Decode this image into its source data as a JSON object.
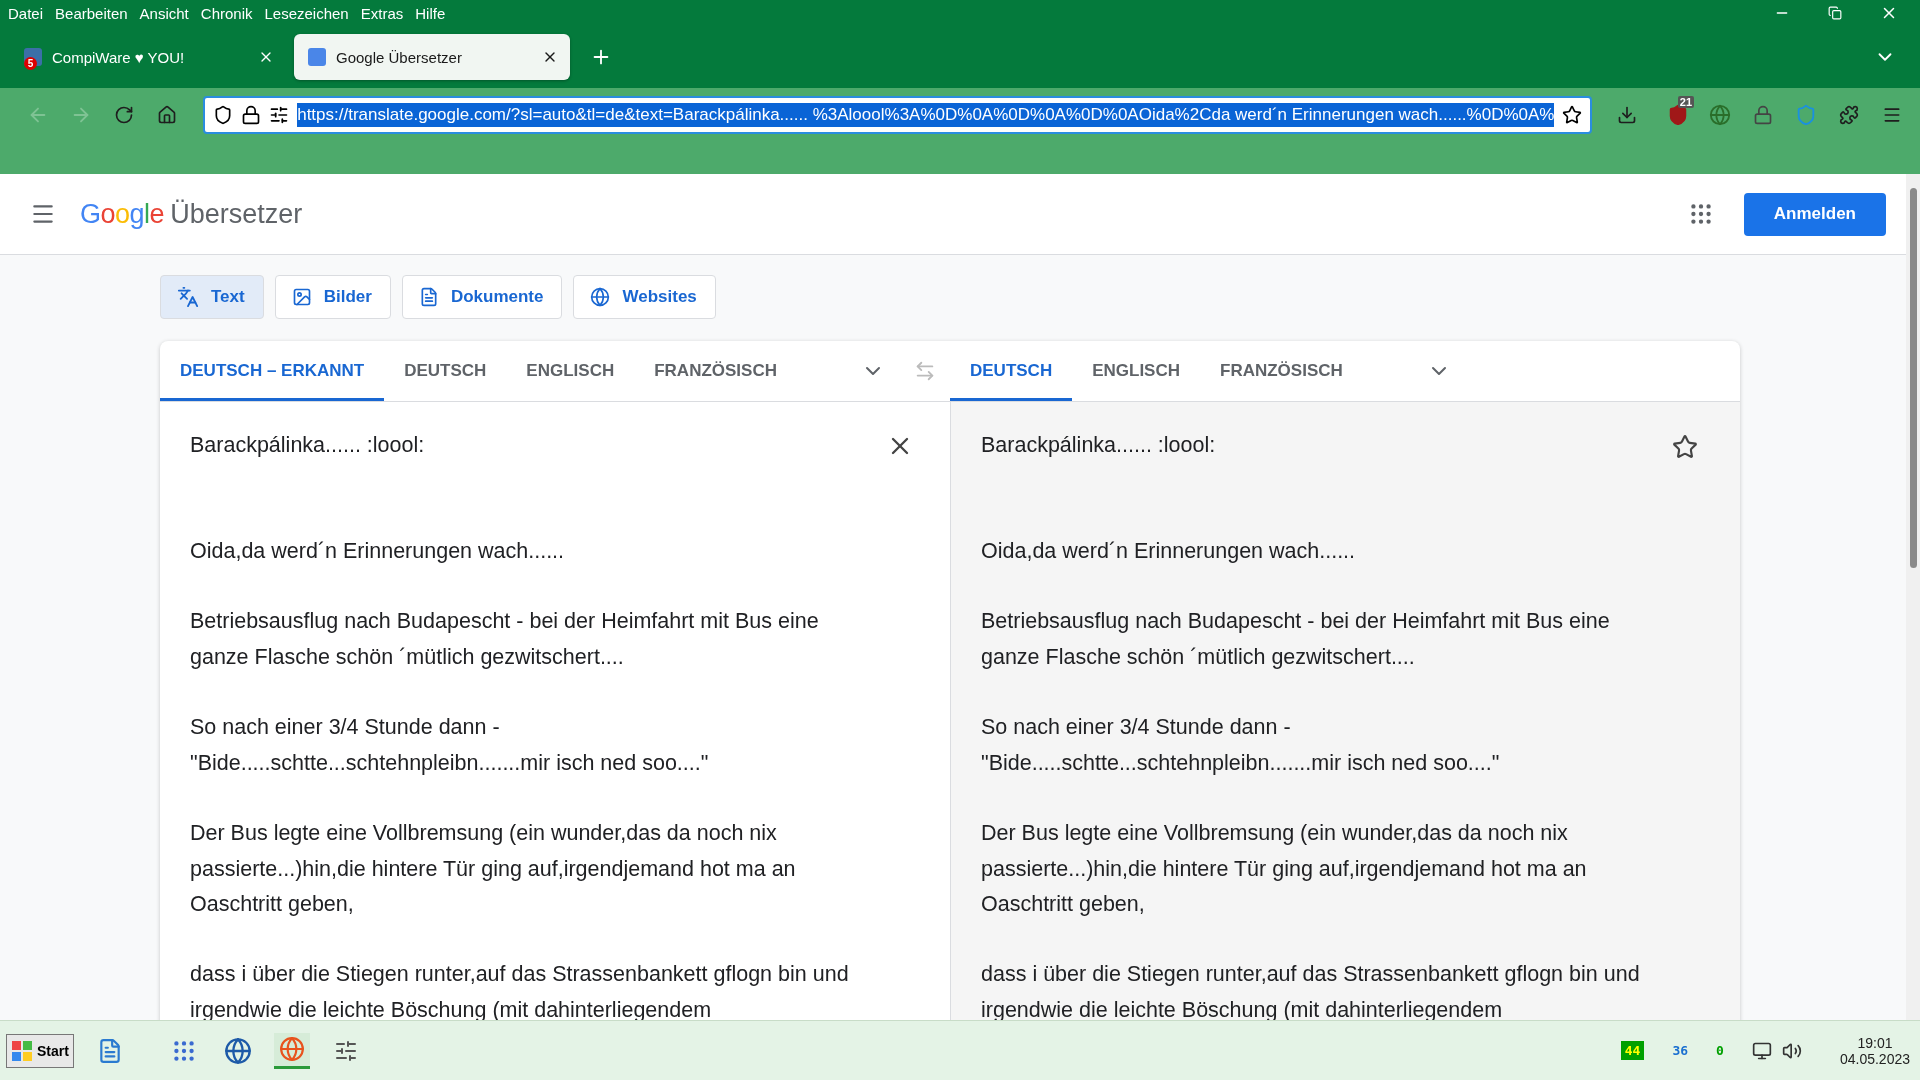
{
  "menu_bar": [
    "Datei",
    "Bearbeiten",
    "Ansicht",
    "Chronik",
    "Lesezeichen",
    "Extras",
    "Hilfe"
  ],
  "browser_tabs": [
    {
      "title": "CompiWare ♥ YOU!",
      "badge": "5",
      "selected": false
    },
    {
      "title": "Google Übersetzer",
      "selected": true
    }
  ],
  "address_bar": {
    "url": "https://translate.google.com/?sl=auto&tl=de&text=Barackpálinka...... %3Aloool%3A%0D%0A%0D%0A%0D%0AOida%2Cda werd´n Erinnerungen wach......%0D%0A%"
  },
  "extension_badge": "21",
  "header": {
    "logo": "Google",
    "product": "Übersetzer",
    "sign_in": "Anmelden"
  },
  "modes": [
    {
      "label": "Text",
      "kind": "text",
      "selected": true
    },
    {
      "label": "Bilder",
      "kind": "images",
      "selected": false
    },
    {
      "label": "Dokumente",
      "kind": "documents",
      "selected": false
    },
    {
      "label": "Websites",
      "kind": "websites",
      "selected": false
    }
  ],
  "source_languages": [
    {
      "label": "DEUTSCH – ERKANNT",
      "selected": true
    },
    {
      "label": "DEUTSCH",
      "selected": false
    },
    {
      "label": "ENGLISCH",
      "selected": false
    },
    {
      "label": "FRANZÖSISCH",
      "selected": false
    }
  ],
  "target_languages": [
    {
      "label": "DEUTSCH",
      "selected": true
    },
    {
      "label": "ENGLISCH",
      "selected": false
    },
    {
      "label": "FRANZÖSISCH",
      "selected": false
    }
  ],
  "source_text": "Barackpálinka...... :loool:\n\n\nOida,da werd´n Erinnerungen wach......\n\nBetriebsausflug nach Budapescht - bei der Heimfahrt mit Bus eine\nganze Flasche schön ´mütlich gezwitschert....\n\nSo nach einer 3/4 Stunde dann -\n\"Bide.....schtte...schtehnpleibn.......mir isch ned soo....\"\n\nDer Bus legte eine Vollbremsung (ein wunder,das da noch nix\npassierte...)hin,die hintere Tür ging auf,irgendjemand hot ma an\nOaschtritt geben,\n\ndass i über die Stiegen runter,auf das Strassenbankett gflogn bin und\nirgendwie die leichte Böschung (mit dahinterliegendem",
  "translation_text": "Barackpálinka...... :loool:\n\n\nOida,da werd´n Erinnerungen wach......\n\nBetriebsausflug nach Budapescht - bei der Heimfahrt mit Bus eine\nganze Flasche schön ´mütlich gezwitschert....\n\nSo nach einer 3/4 Stunde dann -\n\"Bide.....schtte...schtehnpleibn.......mir isch ned soo....\"\n\nDer Bus legte eine Vollbremsung (ein wunder,das da noch nix\npassierte...)hin,die hintere Tür ging auf,irgendjemand hot ma an\nOaschtritt geben,\n\ndass i über die Stiegen runter,auf das Strassenbankett gflogn bin und\nirgendwie die leichte Böschung (mit dahinterliegendem",
  "taskbar": {
    "start": "Start",
    "tray": [
      {
        "text": "44",
        "color": "#00a000",
        "kind": "box"
      },
      {
        "text": "36",
        "color": "#1a6fd0",
        "kind": "plain"
      },
      {
        "text": "0",
        "color": "#00a000",
        "kind": "plain"
      }
    ],
    "time": "19:01",
    "date": "04.05.2023"
  }
}
